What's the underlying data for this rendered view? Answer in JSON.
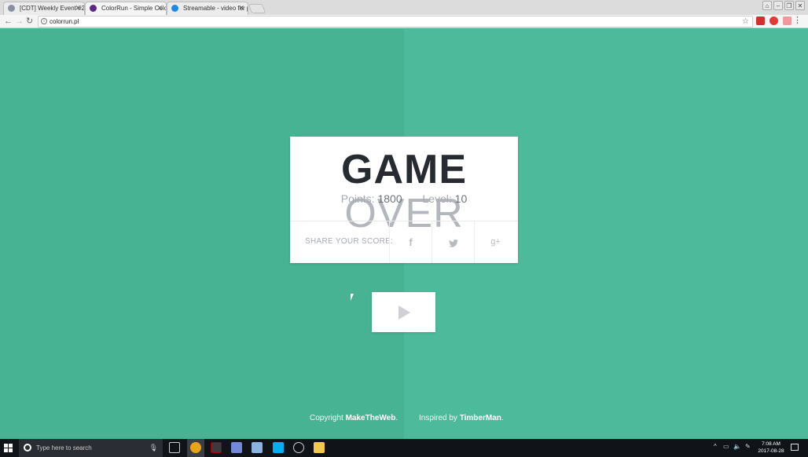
{
  "browser": {
    "tabs": [
      {
        "label": "[CDT] Weekly Event #27",
        "favicon_color": "#8a8fa3"
      },
      {
        "label": "ColorRun - Simple Colo",
        "favicon_color": "#5b2a86"
      },
      {
        "label": "Streamable - video for p",
        "favicon_color": "#1e88e5"
      }
    ],
    "url": "colorrun.pl"
  },
  "game": {
    "title_bold": "GAME",
    "title_light": "OVER",
    "points_label": "Points:",
    "points_value": "1800",
    "level_label": "Level:",
    "level_value": "10",
    "share_label": "SHARE YOUR SCORE:",
    "share_icons": [
      "f",
      "t",
      "g+"
    ]
  },
  "footer": {
    "copyright_prefix": "Copyright",
    "copyright_name": "MakeTheWeb",
    "inspired_prefix": "Inspired by",
    "inspired_name": "TimberMan"
  },
  "taskbar": {
    "search_placeholder": "Type here to search",
    "time": "7:08 AM",
    "date": "2017-08-28"
  },
  "colors": {
    "bg_left": "#47b393",
    "bg_right": "#4dbb9b",
    "title_dark": "#272a31",
    "title_light": "#b3b6bc"
  }
}
